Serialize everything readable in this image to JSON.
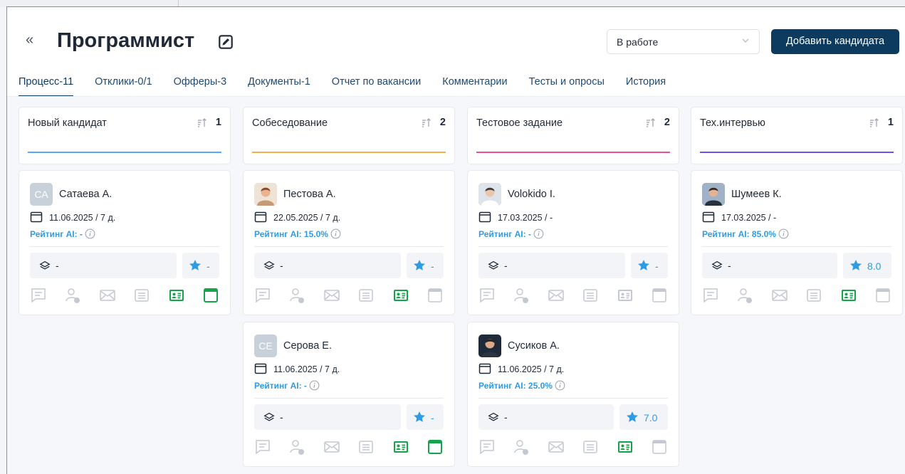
{
  "header": {
    "title": "Программист",
    "status": "В работе",
    "add_candidate": "Добавить кандидата"
  },
  "tabs": [
    {
      "label": "Процесс-11",
      "active": true
    },
    {
      "label": "Отклики-0/1"
    },
    {
      "label": "Офферы-3"
    },
    {
      "label": "Документы-1"
    },
    {
      "label": "Отчет по вакансии"
    },
    {
      "label": "Комментарии"
    },
    {
      "label": "Тесты и опросы"
    },
    {
      "label": "История"
    }
  ],
  "colors": {
    "primary": "#0d3a5f",
    "accent_blue": "#2e9be3",
    "green": "#16a34a",
    "new_candidate": "#5aa9f0",
    "interview": "#f3b04a",
    "test_task": "#ec4f9a",
    "tech_interview": "#6b55e0"
  },
  "columns": [
    {
      "title": "Новый кандидат",
      "count": "1",
      "color": "#5aa9f0",
      "cards": [
        {
          "initials": "СА",
          "photo": false,
          "name": "Сатаева А.",
          "dates": "11.06.2025 / 7 д.",
          "rating": "Рейтинг AI: -",
          "layers": "-",
          "score": "-",
          "doc_active": true,
          "cal_active": true
        }
      ]
    },
    {
      "title": "Собеседование",
      "count": "2",
      "color": "#f3b04a",
      "cards": [
        {
          "initials": "",
          "photo": true,
          "photo_tone": "warm",
          "name": "Пестова А.",
          "dates": "22.05.2025 / 7 д.",
          "rating": "Рейтинг AI: 15.0%",
          "layers": "-",
          "score": "-",
          "doc_active": true,
          "cal_active": false
        },
        {
          "initials": "СЕ",
          "photo": false,
          "name": "Серова Е.",
          "dates": "11.06.2025 / 7 д.",
          "rating": "Рейтинг AI: -",
          "layers": "-",
          "score": "-",
          "doc_active": true,
          "cal_active": true
        }
      ]
    },
    {
      "title": "Тестовое задание",
      "count": "2",
      "color": "#ec4f9a",
      "cards": [
        {
          "initials": "",
          "photo": true,
          "photo_tone": "light",
          "name": "Volokido I.",
          "dates": "17.03.2025 / -",
          "rating": "Рейтинг AI: -",
          "layers": "-",
          "score": "-",
          "doc_active": false,
          "cal_active": false
        },
        {
          "initials": "",
          "photo": true,
          "photo_tone": "dark",
          "name": "Сусиков А.",
          "dates": "11.06.2025 / 7 д.",
          "rating": "Рейтинг AI: 25.0%",
          "layers": "-",
          "score": "7.0",
          "doc_active": true,
          "cal_active": false
        }
      ]
    },
    {
      "title": "Тех.интервью",
      "count": "1",
      "color": "#6b55e0",
      "cards": [
        {
          "initials": "",
          "photo": true,
          "photo_tone": "suit",
          "name": "Шумеев К.",
          "dates": "17.03.2025 / -",
          "rating": "Рейтинг AI: 85.0%",
          "layers": "-",
          "score": "8.0",
          "doc_active": true,
          "cal_active": false
        }
      ]
    }
  ]
}
